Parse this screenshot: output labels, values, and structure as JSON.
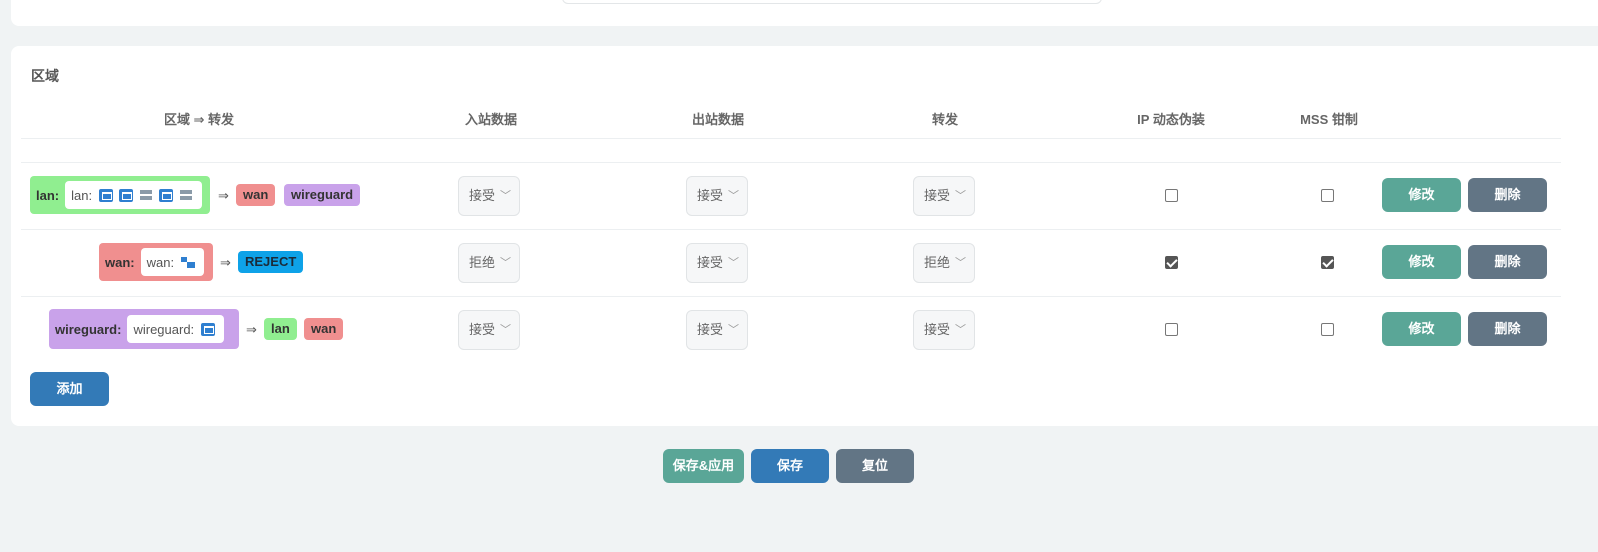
{
  "section_title": "区域",
  "columns": {
    "zone_forward": "区域 ⇒ 转发",
    "input": "入站数据",
    "output": "出站数据",
    "forward": "转发",
    "masq": "IP 动态伪装",
    "mss": "MSS 钳制"
  },
  "arrow": "⇒",
  "rows": [
    {
      "zone": "lan:",
      "iface_label": "lan:",
      "icons": [
        "network-port-icon",
        "network-port-icon",
        "server-icon",
        "network-port-icon",
        "server-icon"
      ],
      "dests": [
        "wan",
        "wireguard"
      ],
      "input": "接受",
      "output": "接受",
      "forward": "接受",
      "masq": false,
      "mss": false,
      "edit": "修改",
      "delete": "删除"
    },
    {
      "zone": "wan:",
      "iface_label": "wan:",
      "icons": [
        "wan-network-icon"
      ],
      "dests": [
        "REJECT"
      ],
      "input": "拒绝",
      "output": "接受",
      "forward": "拒绝",
      "masq": true,
      "mss": true,
      "edit": "修改",
      "delete": "删除"
    },
    {
      "zone": "wireguard:",
      "iface_label": "wireguard:",
      "icons": [
        "network-port-icon"
      ],
      "dests": [
        "lan",
        "wan"
      ],
      "input": "接受",
      "output": "接受",
      "forward": "接受",
      "masq": false,
      "mss": false,
      "edit": "修改",
      "delete": "删除"
    }
  ],
  "add_label": "添加",
  "footer": {
    "save_apply": "保存&应用",
    "save": "保存",
    "reset": "复位"
  },
  "colors": {
    "lan": "#90ee90",
    "wan": "#f08f8f",
    "wireguard": "#c9a2ea",
    "reject": "#0ea2e8",
    "teal_button": "#5aa697",
    "slate_button": "#627585",
    "blue_button": "#337ab7"
  }
}
